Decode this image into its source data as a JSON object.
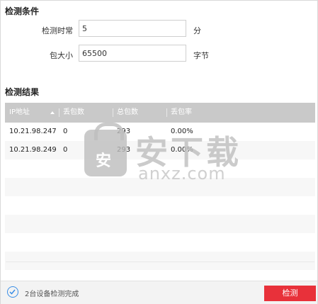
{
  "conditions": {
    "title": "检测条件",
    "time_label": "检测时常",
    "time_value": "5",
    "time_unit": "分",
    "size_label": "包大小",
    "size_value": "65500",
    "size_unit": "字节"
  },
  "results": {
    "title": "检测结果",
    "columns": [
      "IP地址",
      "丢包数",
      "总包数",
      "丢包率"
    ],
    "rows": [
      {
        "ip": "10.21.98.247",
        "lost": "0",
        "total": "293",
        "rate": "0.00%"
      },
      {
        "ip": "10.21.98.249",
        "lost": "0",
        "total": "293",
        "rate": "0.00%"
      }
    ]
  },
  "watermark": {
    "bag_char": "安",
    "text": "安下载",
    "sub": "anxz.com"
  },
  "footer": {
    "status": "2台设备检测完成",
    "detect_button": "检测"
  },
  "colors": {
    "accent_red": "#e8313a",
    "header_gray": "#c9c9c9",
    "check_blue": "#3a8ee6"
  },
  "icons": {
    "status": "check-circle-icon",
    "sort": "sort-ascending-icon"
  }
}
